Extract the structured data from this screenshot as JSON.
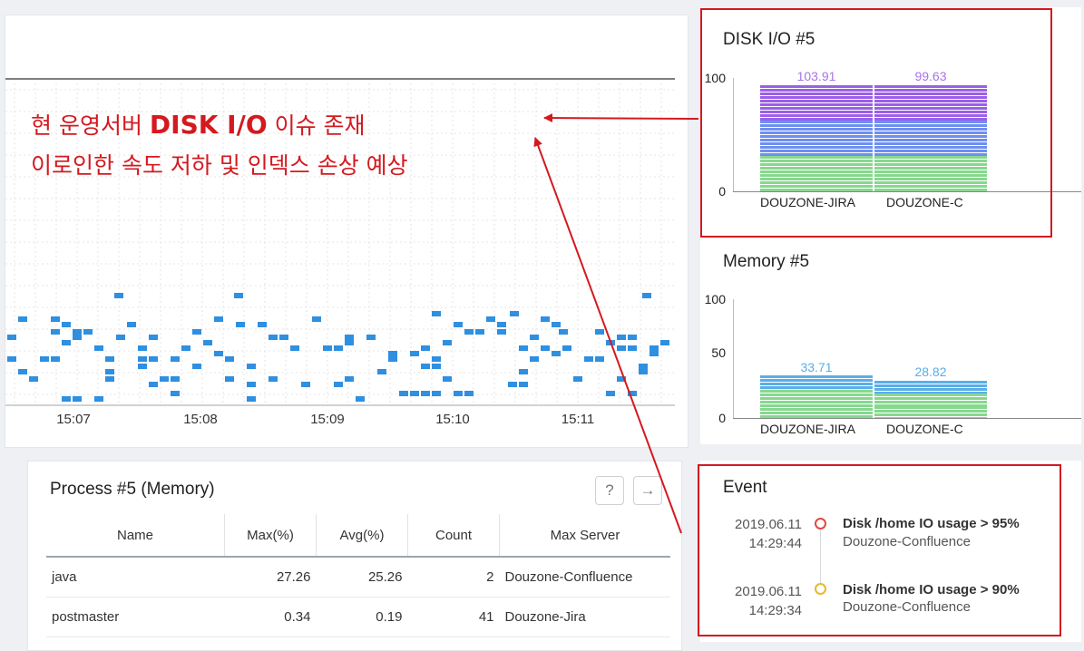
{
  "scatter": {
    "x_ticks": [
      "15:07",
      "15:08",
      "15:09",
      "15:10",
      "15:11"
    ]
  },
  "annotation": {
    "line1_prefix": "현 운영서버 ",
    "line1_strong": "DISK I/O",
    "line1_suffix": " 이슈 존재",
    "line2": "이로인한 속도 저하 및 인덱스 손상 예상"
  },
  "disk": {
    "title": "DISK I/O #5",
    "y_top": "100",
    "y_bottom": "0",
    "bars": [
      {
        "label": "DOUZONE-JIRA",
        "value_text": "103.91"
      },
      {
        "label": "DOUZONE-C",
        "value_text": "99.63"
      }
    ]
  },
  "memory": {
    "title": "Memory #5",
    "y_top": "100",
    "y_mid": "50",
    "y_bottom": "0",
    "bars": [
      {
        "label": "DOUZONE-JIRA",
        "value_text": "33.71"
      },
      {
        "label": "DOUZONE-C",
        "value_text": "28.82"
      }
    ]
  },
  "process": {
    "title": "Process #5 (Memory)",
    "help_glyph": "?",
    "arrow_glyph": "→",
    "columns": [
      "Name",
      "Max(%)",
      "Avg(%)",
      "Count",
      "Max Server"
    ],
    "rows": [
      [
        "java",
        "27.26",
        "25.26",
        "2",
        "Douzone-Confluence"
      ],
      [
        "postmaster",
        "0.34",
        "0.19",
        "41",
        "Douzone-Jira"
      ]
    ]
  },
  "event": {
    "title": "Event",
    "items": [
      {
        "date": "2019.06.11",
        "time": "14:29:44",
        "title": "Disk /home IO usage > 95%",
        "server": "Douzone-Confluence",
        "color": "#e0483f"
      },
      {
        "date": "2019.06.11",
        "time": "14:29:34",
        "title": "Disk /home IO usage > 90%",
        "server": "Douzone-Confluence",
        "color": "#e8b92a"
      }
    ]
  },
  "colors": {
    "accent_red": "#d4191f",
    "scatter_blue": "#2f8fe0",
    "disk_purple": "#9b5fe8",
    "disk_blue": "#6e8ff0",
    "mem_blue": "#5aaee8",
    "bar_green": "#86d88e"
  }
}
